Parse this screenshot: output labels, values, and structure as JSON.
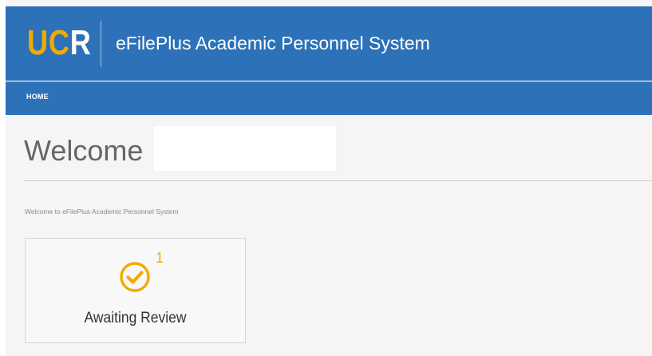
{
  "header": {
    "logo": {
      "text_primary": "UC",
      "text_accent": "R"
    },
    "title": "eFilePlus Academic Personnel System"
  },
  "nav": {
    "items": [
      {
        "label": "HOME"
      }
    ]
  },
  "main": {
    "heading": "Welcome",
    "intro": "Welcome to eFilePlus Academic Personnel System",
    "tiles": [
      {
        "label": "Awaiting Review",
        "count": "1",
        "icon": "check-circle-icon"
      }
    ]
  },
  "colors": {
    "header_bg": "#2d72b8",
    "brand_gold": "#f1ab00",
    "page_bg": "#f5f5f5",
    "heading_text": "#666666"
  }
}
